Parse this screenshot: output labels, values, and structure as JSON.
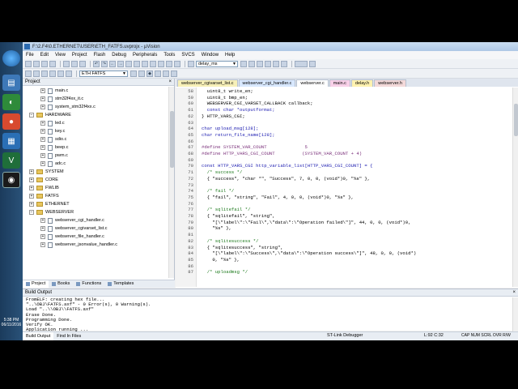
{
  "window": {
    "title": "F:\\2.F4\\0.ETHERNET\\USER\\ETH_FATFS.uvprojx - µVision"
  },
  "menu": [
    "File",
    "Edit",
    "View",
    "Project",
    "Flash",
    "Debug",
    "Peripherals",
    "Tools",
    "SVCS",
    "Window",
    "Help"
  ],
  "toolbar": {
    "find_combo": "delay_ms",
    "target_combo": "ETH FATFS"
  },
  "project": {
    "title": "Project",
    "close": "×",
    "tree": [
      {
        "label": "main.c",
        "kind": "file",
        "indent": 1
      },
      {
        "label": "stm32f4xx_it.c",
        "kind": "file",
        "indent": 1
      },
      {
        "label": "system_stm32f4xx.c",
        "kind": "file",
        "indent": 1
      },
      {
        "label": "HARDWARE",
        "kind": "folder",
        "indent": 0,
        "expanded": true
      },
      {
        "label": "led.c",
        "kind": "file",
        "indent": 1
      },
      {
        "label": "key.c",
        "kind": "file",
        "indent": 1
      },
      {
        "label": "sdio.c",
        "kind": "file",
        "indent": 1
      },
      {
        "label": "beep.c",
        "kind": "file",
        "indent": 1
      },
      {
        "label": "pwm.c",
        "kind": "file",
        "indent": 1
      },
      {
        "label": "adc.c",
        "kind": "file",
        "indent": 1
      },
      {
        "label": "SYSTEM",
        "kind": "folder",
        "indent": 0,
        "expanded": false
      },
      {
        "label": "CORE",
        "kind": "folder",
        "indent": 0,
        "expanded": false
      },
      {
        "label": "FWLIB",
        "kind": "folder",
        "indent": 0,
        "expanded": false
      },
      {
        "label": "FATFS",
        "kind": "folder",
        "indent": 0,
        "expanded": false
      },
      {
        "label": "ETHERNET",
        "kind": "folder",
        "indent": 0,
        "expanded": false
      },
      {
        "label": "WEBSERVER",
        "kind": "folder",
        "indent": 0,
        "expanded": true
      },
      {
        "label": "webserver_cgi_handler.c",
        "kind": "file",
        "indent": 1
      },
      {
        "label": "webserver_cgivarset_list.c",
        "kind": "file",
        "indent": 1
      },
      {
        "label": "webserver_file_handler.c",
        "kind": "file",
        "indent": 1
      },
      {
        "label": "webserver_jsonvalue_handler.c",
        "kind": "file",
        "indent": 1
      }
    ],
    "tabs": [
      "Project",
      "Books",
      "Functions",
      "Templates"
    ]
  },
  "editor": {
    "tabs": [
      {
        "label": "webserver_cgivarset_list.c",
        "color": "#f7f0b8"
      },
      {
        "label": "webserver_cgi_handler.c",
        "color": "#d8e8ff"
      },
      {
        "label": "webserver.c",
        "color": "#ffffff"
      },
      {
        "label": "main.c",
        "color": "#f8d0e8"
      },
      {
        "label": "delay.h",
        "color": "#fff2b0"
      },
      {
        "label": "webserver.h",
        "color": "#f3d9d9"
      }
    ],
    "lines": [
      {
        "n": "58",
        "t": "  uint8_t write_en;",
        "c": ""
      },
      {
        "n": "59",
        "t": "  uint8_t bmp_en;",
        "c": ""
      },
      {
        "n": "60",
        "t": "  WEBSERVER_CGI_VARSET_CALLBACK callback;",
        "c": ""
      },
      {
        "n": "61",
        "t": "  const char *outputformat;",
        "c": "kw"
      },
      {
        "n": "62",
        "t": "} HTTP_VARS_CGI;",
        "c": ""
      },
      {
        "n": "63",
        "t": "",
        "c": ""
      },
      {
        "n": "64",
        "t": "char upload_msg[128];",
        "c": "kw"
      },
      {
        "n": "65",
        "t": "char return_file_name[128];",
        "c": "kw"
      },
      {
        "n": "66",
        "t": "",
        "c": ""
      },
      {
        "n": "67",
        "t": "#define SYSTEM_VAR_COUNT              5",
        "c": "pp"
      },
      {
        "n": "68",
        "t": "#define HTTP_VARS_CGI_COUNT          (SYSTEM_VAR_COUNT + 4)",
        "c": "pp"
      },
      {
        "n": "69",
        "t": "",
        "c": ""
      },
      {
        "n": "70",
        "t": "const HTTP_VARS_CGI http_variable_list[HTTP_VARS_CGI_COUNT] = {",
        "c": "kw"
      },
      {
        "n": "71",
        "t": "  /* success */",
        "c": "cm"
      },
      {
        "n": "72",
        "t": "  { \"success\", \"char *\", \"Success\", 7, 0, 0, (void*)0, \"%s\" },",
        "c": ""
      },
      {
        "n": "73",
        "t": "",
        "c": ""
      },
      {
        "n": "74",
        "t": "  /* fail */",
        "c": "cm"
      },
      {
        "n": "75",
        "t": "  { \"fail\", \"string\", \"Fail\", 4, 0, 0, (void*)0, \"%s\" },",
        "c": ""
      },
      {
        "n": "76",
        "t": "",
        "c": ""
      },
      {
        "n": "77",
        "t": "  /* sqlitefail */",
        "c": "cm"
      },
      {
        "n": "78",
        "t": "  { \"sqlitefail\", \"string\",",
        "c": ""
      },
      {
        "n": "79",
        "t": "    \"[\\\"label\\\":\\\"Fail\\\",\\\"data\\\":\\\"Operation failed\\\"]\", 44, 0, 0, (void*)0,",
        "c": ""
      },
      {
        "n": "80",
        "t": "    \"%s\" },",
        "c": ""
      },
      {
        "n": "81",
        "t": "",
        "c": ""
      },
      {
        "n": "82",
        "t": "  /* sqlitesuccess */",
        "c": "cm"
      },
      {
        "n": "83",
        "t": "  { \"sqlitesuccess\", \"string\",",
        "c": ""
      },
      {
        "n": "84",
        "t": "    \"[\\\"label\\\":\\\"Success\\\",\\\"data\\\":\\\"Operation success\\\"]\", 48, 0, 0, (void*)",
        "c": ""
      },
      {
        "n": "85",
        "t": "    0, \"%s\" },",
        "c": ""
      },
      {
        "n": "86",
        "t": "",
        "c": ""
      },
      {
        "n": "87",
        "t": "  /* uploadmsg */",
        "c": "cm"
      }
    ]
  },
  "build": {
    "title": "Build Output",
    "close": "×",
    "lines": [
      "FromELF: creating hex file...",
      "\"..\\OBJ\\FATFS.axf\" - 0 Error(s), 0 Warning(s).",
      "Load \"..\\\\OBJ\\\\FATFS.axf\"",
      "Erase Done.",
      "Programming Done.",
      "Verify OK.",
      "Application running ...",
      "Flash Load finished at 17:36:57"
    ],
    "tabs": [
      "Build Output",
      "Find In Files"
    ]
  },
  "statusbar": {
    "debugger": "ST-Link Debugger",
    "position": "L:92 C:32",
    "flags": "CAP  NUM  SCRL  OVR  R/W"
  },
  "taskbar": {
    "time": "5:38 PM",
    "date": "06/11/2016"
  }
}
